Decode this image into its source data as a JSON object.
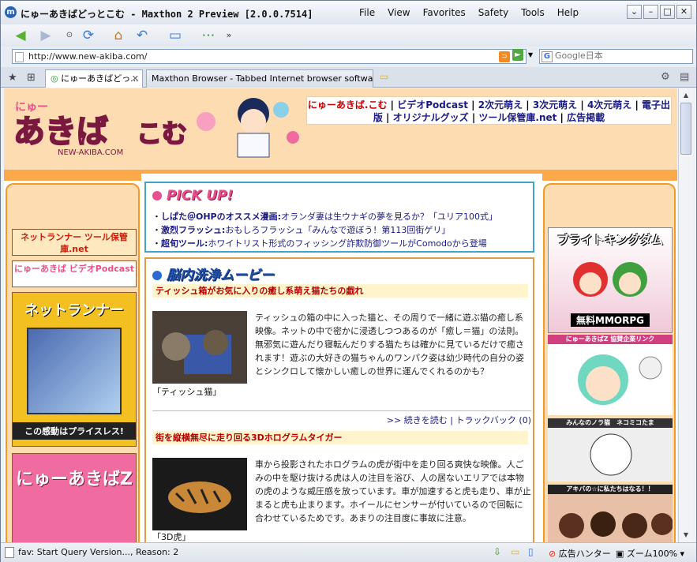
{
  "window": {
    "title": "にゅーあきばどっとこむ - Maxthon 2 Preview [2.0.0.7514]"
  },
  "menu": {
    "file": "File",
    "view": "View",
    "favorites": "Favorites",
    "safety": "Safety",
    "tools": "Tools",
    "help": "Help"
  },
  "address": {
    "url": "http://www.new-akiba.com/",
    "search_placeholder": "Google日本"
  },
  "tabs": {
    "tab1": "にゅーあきばどっ...",
    "tab2": "Maxthon Browser - Tabbed Internet browser software"
  },
  "nav": {
    "site": "にゅーあきば.こむ",
    "l1": "ビデオPodcast",
    "l2": "2次元萌え",
    "l3": "3次元萌え",
    "l4": "4次元萌え",
    "l5": "電子出版",
    "l6": "オリジナルグッズ",
    "l7": "ツール保管庫.net",
    "l8": "広告掲載"
  },
  "pickup": {
    "title": "PICK UP!",
    "items": [
      {
        "key": "しぱた＠OHPのオススメ漫画:",
        "val": "オランダ妻は生ウナギの夢を見るか？「ユリア100式」"
      },
      {
        "key": "激烈フラッシュ:",
        "val": "おもしろフラッシュ「みんなで遊ぼう！第113回街ゲリ」"
      },
      {
        "key": "超旬ツール:",
        "val": "ホワイトリスト形式のフィッシング詐欺防御ツールがComodoから登場"
      }
    ]
  },
  "movie": {
    "title": "脳内洗浄ムービー",
    "a1": {
      "heading": "ティッシュ箱がお気に入りの癒し系萌え猫たちの戯れ",
      "caption": "「ティッシュ猫」",
      "body": "ティッシュの箱の中に入った猫と、その周りで一緒に遊ぶ猫の癒し系映像。ネットの中で密かに浸透しつつあるのが「癒し＝猫」の法則。無邪気に遊んだり寝転んだりする猫たちは確かに見ているだけで癒されます！遊ぶの大好きの猫ちゃんのワンパク姿は幼少時代の自分の姿とシンクロして懐かしい癒しの世界に運んでくれるのかも？",
      "more": ">> 続きを読む | トラックバック (0)"
    },
    "a2": {
      "heading": "街を縦横無尽に走り回る3Dホログラムタイガー",
      "caption": "「3D虎」",
      "body": "車から投影されたホログラムの虎が街中を走り回る爽快な映像。人ごみの中を駆け抜ける虎は人の注目を浴び、人の居ないエリアでは本物の虎のような威圧感を放っています。車が加速すると虎も走り、車が止まると虎も止まります。ホイールにセンサーが付いているので回転に合わせているためです。あまりの注目度に事故に注意。"
    }
  },
  "left": {
    "b1": "ネットランナー ツール保管庫.net",
    "b2": "にゅーあきば ビデオPodcast",
    "mag_title": "ネットランナー",
    "mag_bottom": "この感動はプライスレス!",
    "book_title": "にゅーあきばZ"
  },
  "right": {
    "ad1": "ブライトキングダム",
    "ad1_sub": "無料MMORPG",
    "h1": "にゅーあきばZ 協賛企業リンク",
    "h2": "みんなのノラ猫　ネコミコたま",
    "h3": "アキバの☆に私たちはなる！！"
  },
  "status": {
    "text": "fav: Start Query Version..., Reason: 2",
    "ad": "広告ハンター",
    "zoom": "ズーム100%"
  }
}
